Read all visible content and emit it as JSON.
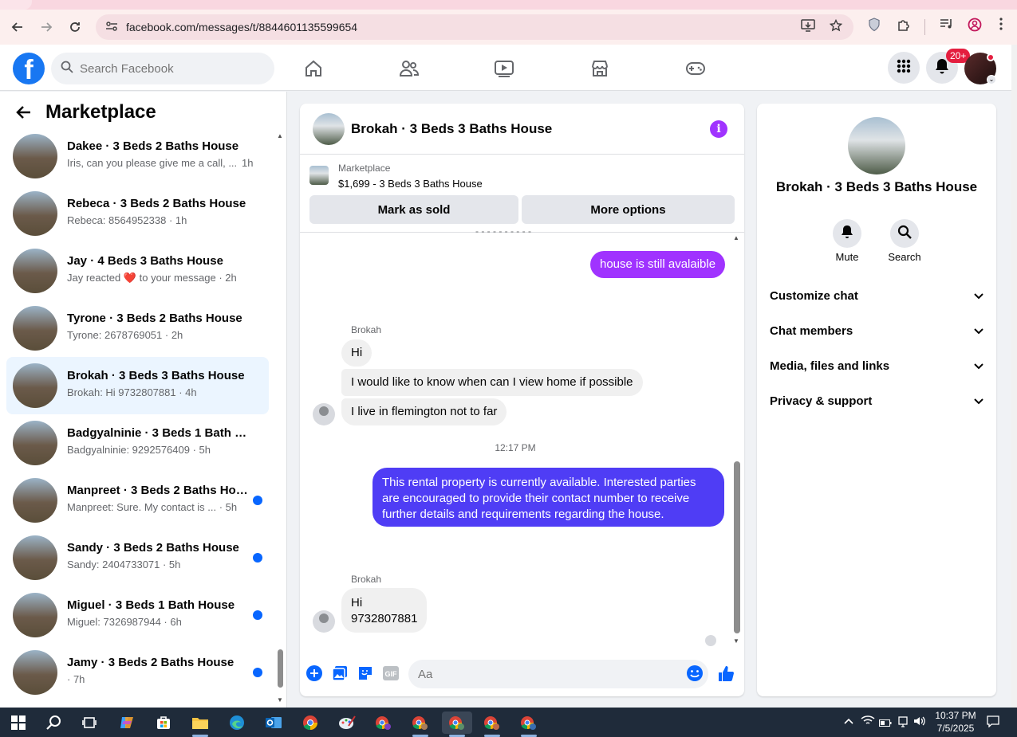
{
  "browser": {
    "url": "facebook.com/messages/t/8844601135599654"
  },
  "fb": {
    "search_placeholder": "Search Facebook",
    "notifications_badge": "20+"
  },
  "left": {
    "title": "Marketplace",
    "conversations": [
      {
        "name": "Dakee · 3 Beds 2 Baths House",
        "preview": "Iris, can you please give me a call, ...",
        "time": "1h",
        "unread": false,
        "active": false
      },
      {
        "name": "Rebeca · 3 Beds 2 Baths House",
        "preview": "Rebeca: 8564952338 · 1h",
        "time": "",
        "unread": false,
        "active": false
      },
      {
        "name": "Jay · 4 Beds 3 Baths House",
        "preview": "Jay reacted ❤️ to your message · 2h",
        "time": "",
        "unread": false,
        "active": false
      },
      {
        "name": "Tyrone · 3 Beds 2 Baths House",
        "preview": "Tyrone: 2678769051 · 2h",
        "time": "",
        "unread": false,
        "active": false
      },
      {
        "name": "Brokah · 3 Beds 3 Baths House",
        "preview": "Brokah: Hi 9732807881 · 4h",
        "time": "",
        "unread": false,
        "active": true
      },
      {
        "name": "Badgyalninie · 3 Beds 1 Bath Ho...",
        "preview": "Badgyalninie: 9292576409 · 5h",
        "time": "",
        "unread": false,
        "active": false
      },
      {
        "name": "Manpreet · 3 Beds 2 Baths Hou...",
        "preview": "Manpreet: Sure. My contact is ... · 5h",
        "time": "",
        "unread": true,
        "active": false
      },
      {
        "name": "Sandy · 3 Beds 2 Baths House",
        "preview": "Sandy: 2404733071 · 5h",
        "time": "",
        "unread": true,
        "active": false
      },
      {
        "name": "Miguel · 3 Beds 1 Bath House",
        "preview": "Miguel: 7326987944 · 6h",
        "time": "",
        "unread": true,
        "active": false
      },
      {
        "name": "Jamy · 3 Beds 2 Baths House",
        "preview": "· 7h",
        "time": "",
        "unread": true,
        "active": false
      }
    ]
  },
  "chat": {
    "title": "Brokah · 3 Beds 3 Baths House",
    "listing_label": "Marketplace",
    "listing_price": "$1,699 - 3 Beds 3 Baths House",
    "mark_sold": "Mark as sold",
    "more_options": "More options",
    "msg_out_1": "house is still avalaible",
    "sender_1": "Brokah",
    "msg_in_1": "Hi",
    "msg_in_2": "I would like to know when can I view home if possible",
    "msg_in_3": "I live in flemington not to far",
    "timestamp": "12:17 PM",
    "msg_out_2": "This rental property is currently available. Interested parties are encouraged to provide their contact number to receive further details and requirements regarding the house.",
    "sender_2": "Brokah",
    "msg_in_4_line1": "Hi",
    "msg_in_4_line2": "9732807881",
    "composer_placeholder": "Aa"
  },
  "right": {
    "title": "Brokah · 3 Beds 3 Baths House",
    "mute": "Mute",
    "search": "Search",
    "rows": [
      "Customize chat",
      "Chat members",
      "Media, files and links",
      "Privacy & support"
    ]
  },
  "taskbar": {
    "time": "10:37 PM",
    "date": "7/5/2025"
  },
  "colors": {
    "fb_blue": "#1877f2",
    "accent_purple": "#a033ff",
    "out_bubble_blue": "#4f3df5",
    "unread_dot": "#0866ff"
  }
}
